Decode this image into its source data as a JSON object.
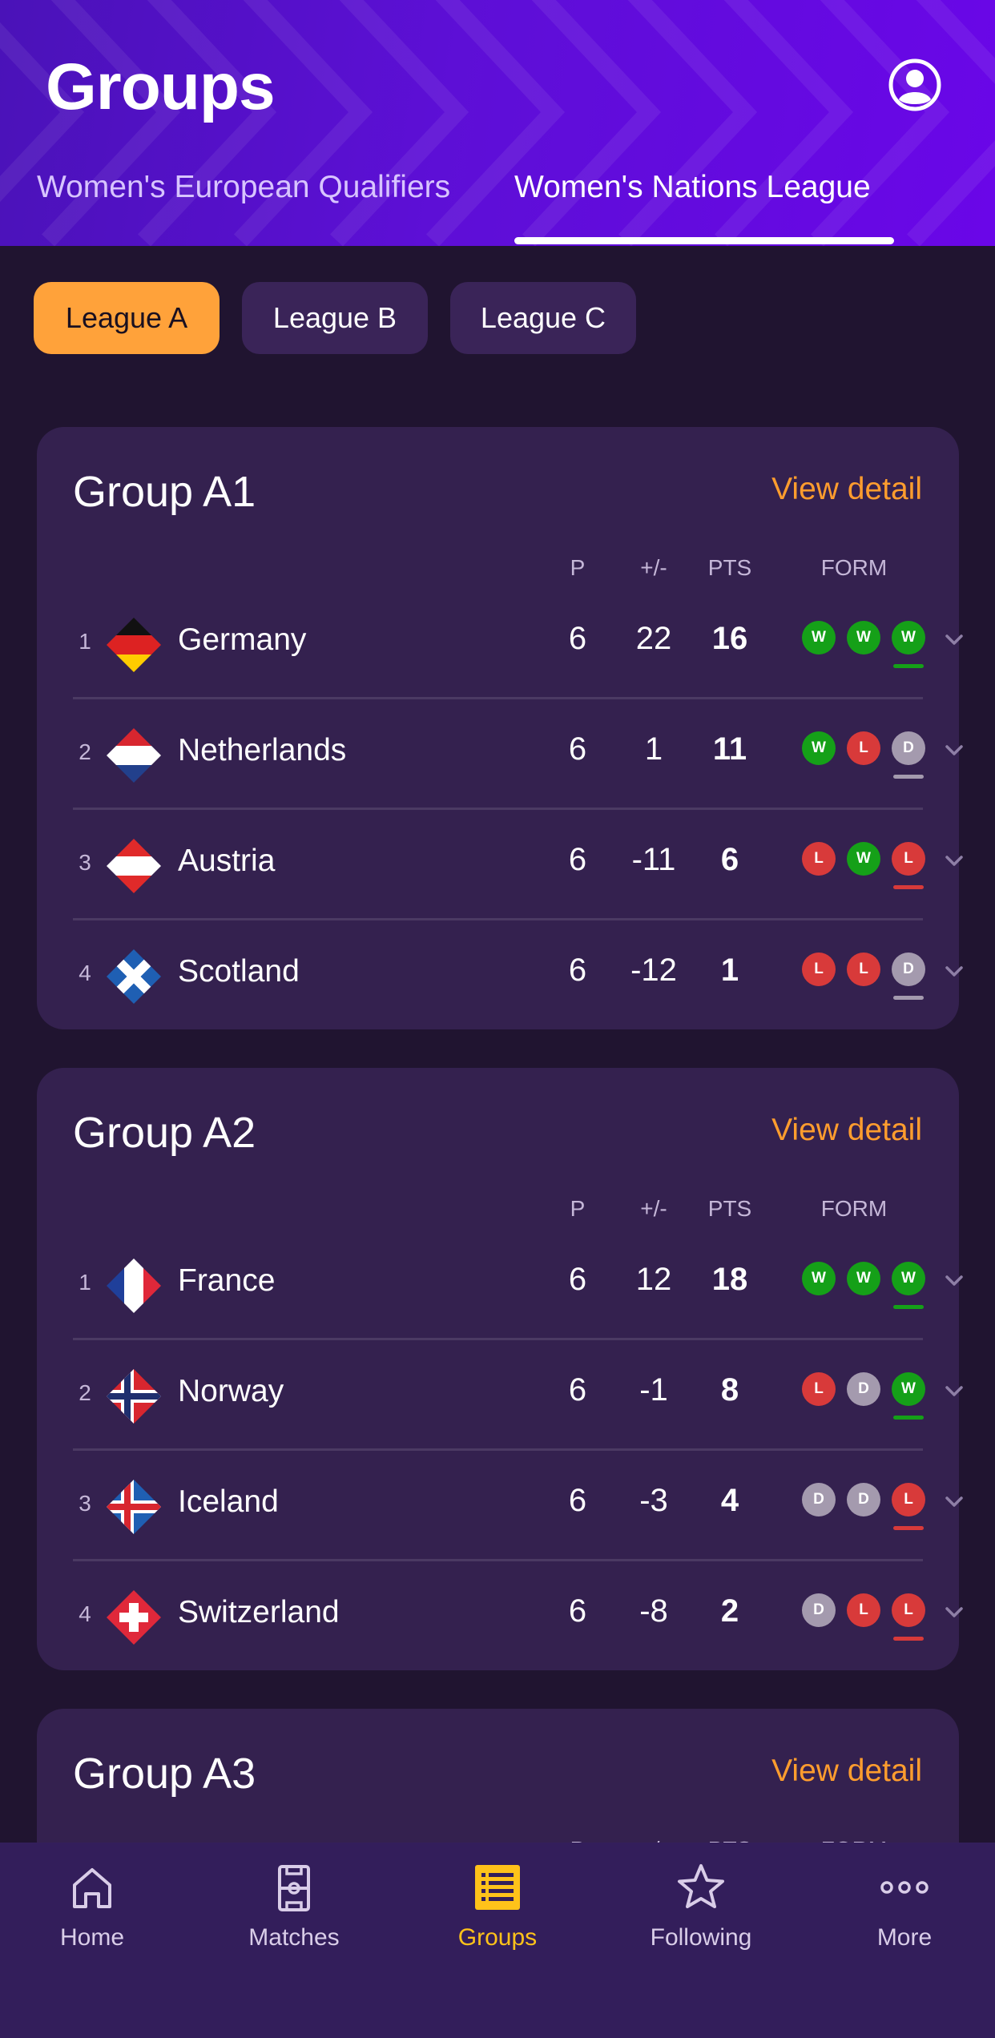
{
  "header": {
    "title": "Groups",
    "tabs": [
      {
        "label": "Women's European Qualifiers"
      },
      {
        "label": "Women's Nations League"
      }
    ]
  },
  "leagues": [
    {
      "label": "League A"
    },
    {
      "label": "League B"
    },
    {
      "label": "League C"
    }
  ],
  "columns": {
    "p": "P",
    "gd": "+/-",
    "pts": "PTS",
    "form": "FORM"
  },
  "groups": [
    {
      "title": "Group A1",
      "view_detail": "View detail",
      "rows": [
        {
          "rank": "1",
          "team": "Germany",
          "p": "6",
          "gd": "22",
          "pts": "16",
          "form": [
            "W",
            "W",
            "W"
          ]
        },
        {
          "rank": "2",
          "team": "Netherlands",
          "p": "6",
          "gd": "1",
          "pts": "11",
          "form": [
            "W",
            "L",
            "D"
          ]
        },
        {
          "rank": "3",
          "team": "Austria",
          "p": "6",
          "gd": "-11",
          "pts": "6",
          "form": [
            "L",
            "W",
            "L"
          ]
        },
        {
          "rank": "4",
          "team": "Scotland",
          "p": "6",
          "gd": "-12",
          "pts": "1",
          "form": [
            "L",
            "L",
            "D"
          ]
        }
      ]
    },
    {
      "title": "Group A2",
      "view_detail": "View detail",
      "rows": [
        {
          "rank": "1",
          "team": "France",
          "p": "6",
          "gd": "12",
          "pts": "18",
          "form": [
            "W",
            "W",
            "W"
          ]
        },
        {
          "rank": "2",
          "team": "Norway",
          "p": "6",
          "gd": "-1",
          "pts": "8",
          "form": [
            "L",
            "D",
            "W"
          ]
        },
        {
          "rank": "3",
          "team": "Iceland",
          "p": "6",
          "gd": "-3",
          "pts": "4",
          "form": [
            "D",
            "D",
            "L"
          ]
        },
        {
          "rank": "4",
          "team": "Switzerland",
          "p": "6",
          "gd": "-8",
          "pts": "2",
          "form": [
            "D",
            "L",
            "L"
          ]
        }
      ]
    },
    {
      "title": "Group A3",
      "view_detail": "View detail"
    }
  ],
  "nav": [
    {
      "label": "Home"
    },
    {
      "label": "Matches"
    },
    {
      "label": "Groups"
    },
    {
      "label": "Following"
    },
    {
      "label": "More"
    }
  ],
  "colors": {
    "accent_orange": "#ffa23a",
    "active_yellow": "#ffc21a",
    "win": "#15a018",
    "loss": "#d83a3a",
    "draw": "#a49aae"
  }
}
